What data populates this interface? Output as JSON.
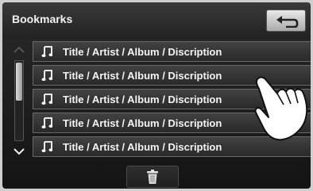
{
  "header": {
    "title": "Bookmarks"
  },
  "controls": {
    "back_icon": "back-arrow-icon",
    "scroll_up_icon": "chevron-up-icon",
    "scroll_down_icon": "chevron-down-icon",
    "delete_icon": "trash-icon"
  },
  "bookmarks": {
    "items": [
      {
        "label": "Title / Artist / Album / Discription",
        "icon": "music-note-icon"
      },
      {
        "label": "Title / Artist / Album / Discription",
        "icon": "music-note-icon"
      },
      {
        "label": "Title / Artist / Album / Discription",
        "icon": "music-note-icon"
      },
      {
        "label": "Title / Artist / Album / Discription",
        "icon": "music-note-icon"
      },
      {
        "label": "Title / Artist / Album / Discription",
        "icon": "music-note-icon"
      }
    ]
  },
  "colors": {
    "background": "#141414",
    "text": "#f4f4f4",
    "button_light": "#e9e9e9"
  }
}
